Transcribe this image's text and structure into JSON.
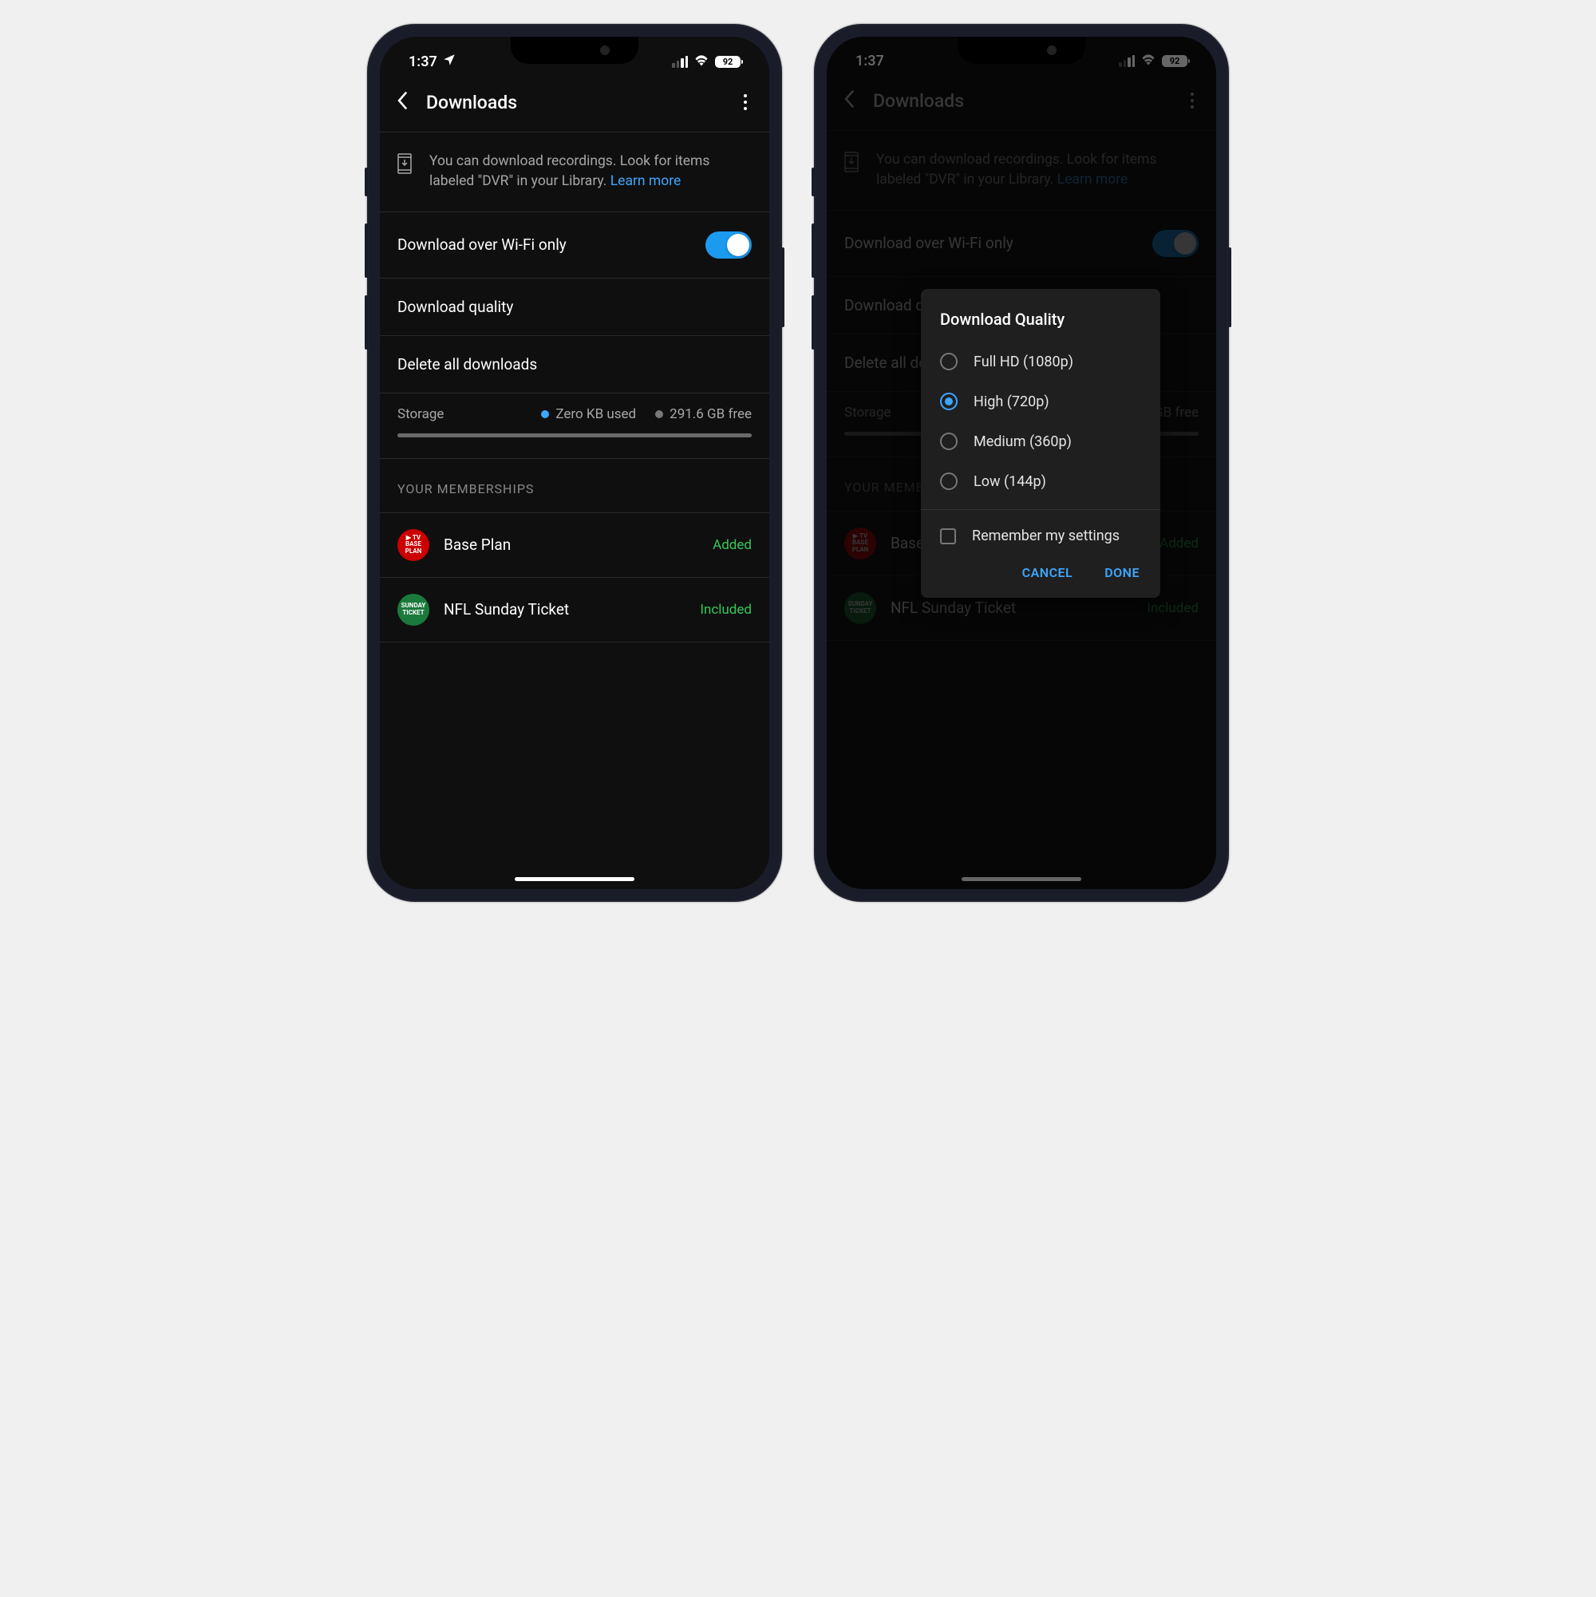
{
  "status": {
    "time": "1:37",
    "battery": "92"
  },
  "nav": {
    "title": "Downloads"
  },
  "info": {
    "text": "You can download recordings. Look for items labeled \"DVR\" in your Library. ",
    "link": "Learn more"
  },
  "settings": {
    "wifi_only": "Download over Wi-Fi only",
    "quality": "Download quality",
    "delete_all": "Delete all downloads"
  },
  "storage": {
    "label": "Storage",
    "used": "Zero KB used",
    "free": "291.6 GB free"
  },
  "memberships": {
    "header": "YOUR MEMBERSHIPS",
    "items": [
      {
        "name": "Base Plan",
        "status": "Added",
        "icon_text": "▶ TV\nBASE\nPLAN"
      },
      {
        "name": "NFL Sunday Ticket",
        "status": "Included",
        "icon_text": "SUNDAY\nTICKET"
      }
    ]
  },
  "dialog": {
    "title": "Download Quality",
    "options": [
      {
        "label": "Full HD (1080p)",
        "selected": false
      },
      {
        "label": "High (720p)",
        "selected": true
      },
      {
        "label": "Medium (360p)",
        "selected": false
      },
      {
        "label": "Low (144p)",
        "selected": false
      }
    ],
    "remember": "Remember my settings",
    "cancel": "CANCEL",
    "done": "DONE"
  }
}
